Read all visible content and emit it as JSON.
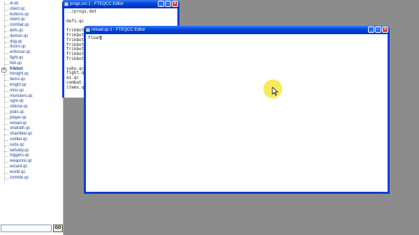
{
  "sidebar": {
    "files": [
      "ai.qc",
      "client.qc",
      "buttons.qc",
      "client.qc",
      "combat.qc",
      "defs.qc",
      "demon.qc",
      "dog.qc",
      "doors.qc",
      "enforcer.qc",
      "fight.qc",
      "fish.qc",
      "frikbot",
      "hknight.qc",
      "items.qc",
      "knight.qc",
      "misc.qc",
      "monsters.qc",
      "ogre.qc",
      "oldone.qc",
      "plats.qc",
      "player.qc",
      "reload.qc",
      "shalrath.qc",
      "shambler.qc",
      "soldier.qc",
      "subs.qc",
      "tarbaby.qc",
      "triggers.qc",
      "weapons.qc",
      "wizard.qc",
      "world.qc",
      "zombie.qc"
    ],
    "expander_symbol": "+",
    "search_value": "",
    "go_label": "GO"
  },
  "progs_window": {
    "title": "progs.src:1 - FTEQCC Editor",
    "lines": [
      "../progs.dat",
      "",
      "defs.qc",
      "",
      "frikbot",
      "frikbot",
      "frikbot",
      "frikbot",
      "frikbot",
      "frikbot",
      "frikbot",
      "",
      "subs.qc",
      "fight.qc",
      "ai.qc",
      "combat.qc",
      "items.qc"
    ]
  },
  "reload_window": {
    "title": "reload.qc:1 - FTEQCC Editor",
    "content": "float"
  },
  "window_controls": {
    "minimize": "_",
    "maximize": "□",
    "close": "✕"
  }
}
